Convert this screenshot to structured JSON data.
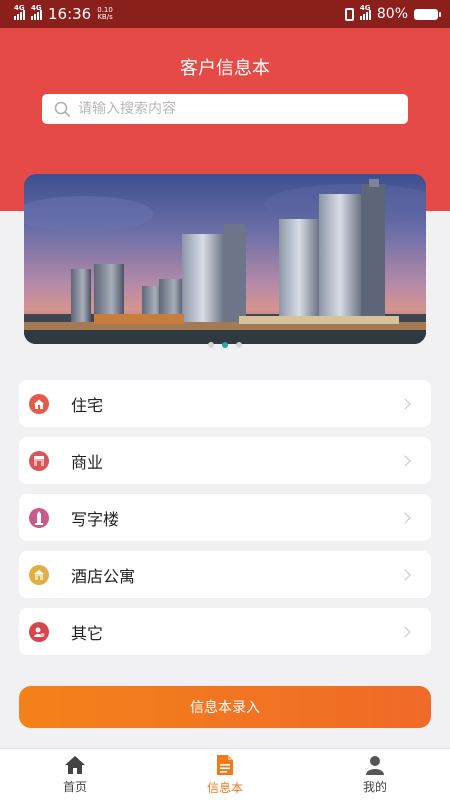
{
  "status_bar": {
    "network1": "4G",
    "network2": "4G",
    "time": "16:36",
    "speed_value": "0.10",
    "speed_unit": "KB/s",
    "network3": "4G",
    "battery": "80%"
  },
  "header": {
    "title": "客户信息本"
  },
  "search": {
    "placeholder": "请输入搜索内容"
  },
  "banner": {
    "slide_count": 3,
    "active_slide": 2
  },
  "menu": {
    "items": [
      {
        "label": "住宅",
        "icon": "house-icon",
        "color": "#e85a48"
      },
      {
        "label": "商业",
        "icon": "shop-icon",
        "color": "#d9555a"
      },
      {
        "label": "写字楼",
        "icon": "office-tower-icon",
        "color": "#c85a8e"
      },
      {
        "label": "酒店公寓",
        "icon": "hotel-icon",
        "color": "#e0b046"
      },
      {
        "label": "其它",
        "icon": "other-icon",
        "color": "#d8454c"
      }
    ]
  },
  "action": {
    "entry_label": "信息本录入"
  },
  "tabbar": {
    "tabs": [
      {
        "label": "首页",
        "icon": "home-icon"
      },
      {
        "label": "信息本",
        "icon": "document-icon",
        "active": true
      },
      {
        "label": "我的",
        "icon": "user-icon"
      }
    ]
  },
  "colors": {
    "status_bar": "#8b1f1c",
    "header": "#e64a47",
    "accent": "#f07a1c",
    "page_bg": "#f1f1f3"
  }
}
